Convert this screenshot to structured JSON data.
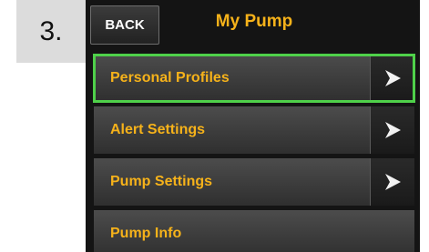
{
  "step": {
    "number": "3."
  },
  "header": {
    "back_label": "BACK",
    "title": "My Pump"
  },
  "menu": {
    "items": [
      {
        "label": "Personal Profiles",
        "has_arrow": true,
        "selected": true
      },
      {
        "label": "Alert Settings",
        "has_arrow": true,
        "selected": false
      },
      {
        "label": "Pump Settings",
        "has_arrow": true,
        "selected": false
      },
      {
        "label": "Pump Info",
        "has_arrow": false,
        "selected": false
      }
    ]
  },
  "colors": {
    "accent_text": "#f6b21a",
    "selection_outline": "#4fd14a",
    "screen_background": "#141414"
  },
  "icons": {
    "arrow": "chevron-right-icon"
  }
}
